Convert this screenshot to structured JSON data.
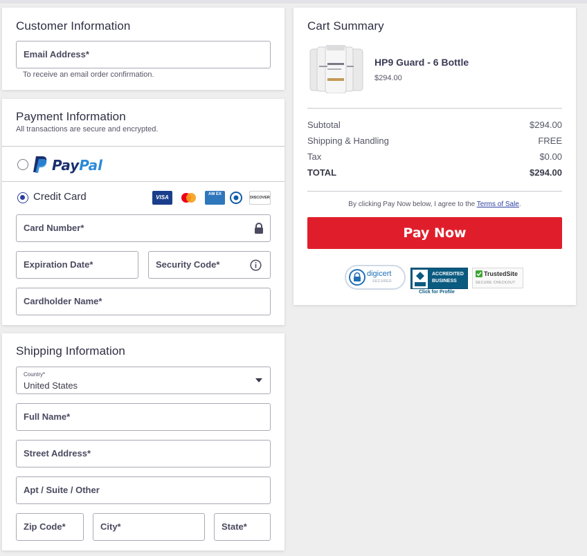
{
  "customer": {
    "title": "Customer Information",
    "email_label": "Email Address*",
    "email_hint": "To receive an email order confirmation."
  },
  "payment": {
    "title": "Payment Information",
    "subtitle": "All transactions are secure and encrypted.",
    "paypal": {
      "pay": "Pay",
      "pal": "Pal",
      "selected": false
    },
    "credit_card": {
      "label": "Credit Card",
      "selected": true
    },
    "card_brands": [
      {
        "name": "VISA",
        "color": "#1a3e8c"
      },
      {
        "name": "mastercard",
        "color": "#ffffff"
      },
      {
        "name": "AM EX",
        "color": "#2e77bc"
      },
      {
        "name": "Diners",
        "color": "#ffffff"
      },
      {
        "name": "DISCOVER",
        "color": "#ffffff"
      }
    ],
    "card_number_label": "Card Number*",
    "expiration_label": "Expiration Date*",
    "security_label": "Security Code*",
    "cardholder_label": "Cardholder Name*"
  },
  "shipping": {
    "title": "Shipping Information",
    "country_label": "Country*",
    "country_value": "United States",
    "full_name_label": "Full Name*",
    "street_label": "Street Address*",
    "apt_label": "Apt / Suite / Other",
    "zip_label": "Zip Code*",
    "city_label": "City*",
    "state_label": "State*"
  },
  "cart": {
    "title": "Cart Summary",
    "product_name": "HP9 Guard - 6 Bottle",
    "product_price": "$294.00",
    "rows": [
      {
        "label": "Subtotal",
        "value": "$294.00"
      },
      {
        "label": "Shipping & Handling",
        "value": "FREE"
      },
      {
        "label": "Tax",
        "value": "$0.00"
      },
      {
        "label": "TOTAL",
        "value": "$294.00"
      }
    ],
    "terms_prefix": "By clicking Pay Now below, I agree to the ",
    "terms_link": "Terms of Sale",
    "terms_suffix": ".",
    "pay_button": "Pay Now",
    "badges": {
      "digicert": "digicert",
      "digicert_sub": "SECURED",
      "bbb_line1": "ACCREDITED",
      "bbb_line2": "BUSINESS",
      "bbb_sub": "Click for Profile",
      "trusted": "TrustedSite",
      "trusted_sub": "SECURE CHECKOUT"
    }
  },
  "colors": {
    "accent": "#2c3e9e",
    "pay_button": "#e01e2b",
    "paypal_dark": "#1a2f6e",
    "paypal_light": "#2b8ad8"
  }
}
